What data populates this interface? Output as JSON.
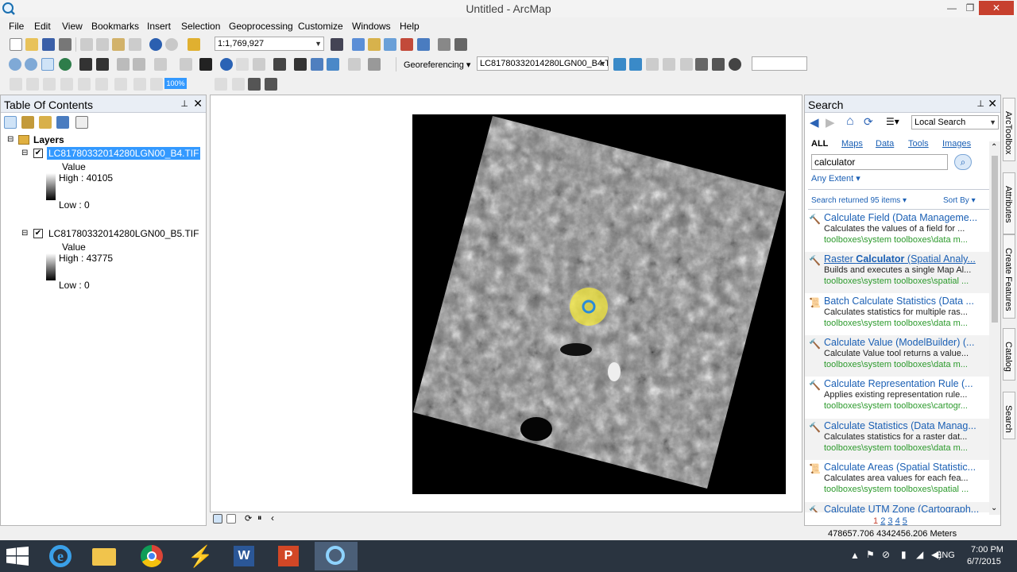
{
  "window": {
    "title": "Untitled - ArcMap",
    "minimize": "—",
    "maximize": "❐",
    "close": "✕"
  },
  "menu": [
    "File",
    "Edit",
    "View",
    "Bookmarks",
    "Insert",
    "Selection",
    "Geoprocessing",
    "Customize",
    "Windows",
    "Help"
  ],
  "toolbar": {
    "scale": "1:1,769,927",
    "georef_label": "Georeferencing ▾",
    "georef_layer": "LC81780332014280LGN00_B4.T",
    "georef_input": "",
    "selected_tool_value": "100%"
  },
  "toc": {
    "title": "Table Of Contents",
    "pin": "📌",
    "close": "✕",
    "layers_label": "Layers",
    "layer1": {
      "name": "LC81780332014280LGN00_B4.TIF",
      "field": "Value",
      "high": "High : 40105",
      "low": "Low : 0"
    },
    "layer2": {
      "name": "LC81780332014280LGN00_B5.TIF",
      "field": "Value",
      "high": "High : 43775",
      "low": "Low : 0"
    }
  },
  "search": {
    "title": "Search",
    "scope": "Local Search",
    "tabs": [
      "ALL",
      "Maps",
      "Data",
      "Tools",
      "Images"
    ],
    "query": "calculator",
    "extent": "Any Extent ▾",
    "count": "Search returned 95 items ▾",
    "sort": "Sort By ▾",
    "results": [
      {
        "title": "Calculate Field (Data Manageme...",
        "desc": "Calculates the values of a field for ...",
        "path": "toolboxes\\system toolboxes\\data m..."
      },
      {
        "title_pre": "Raster ",
        "title_bold": "Calculator",
        "title_post": " (Spatial Analy...",
        "desc": "Builds and executes a single Map Al...",
        "path": "toolboxes\\system toolboxes\\spatial ..."
      },
      {
        "title": "Batch Calculate Statistics (Data ...",
        "desc": "Calculates statistics for multiple ras...",
        "path": "toolboxes\\system toolboxes\\data m..."
      },
      {
        "title": "Calculate Value (ModelBuilder) (...",
        "desc": "Calculate Value tool returns a value...",
        "path": "toolboxes\\system toolboxes\\data m..."
      },
      {
        "title": "Calculate Representation Rule (...",
        "desc": "Applies existing representation rule...",
        "path": "toolboxes\\system toolboxes\\cartogr..."
      },
      {
        "title": "Calculate Statistics (Data Manag...",
        "desc": "Calculates statistics for a raster dat...",
        "path": "toolboxes\\system toolboxes\\data m..."
      },
      {
        "title": "Calculate Areas (Spatial Statistic...",
        "desc": "Calculates area values for each fea...",
        "path": "toolboxes\\system toolboxes\\spatial ..."
      },
      {
        "title": "Calculate UTM Zone (Cartograph...",
        "desc": "",
        "path": ""
      }
    ],
    "pages": [
      "1",
      "2",
      "3",
      "4",
      "5"
    ]
  },
  "dock_tabs": [
    "ArcToolbox",
    "Attributes",
    "Create Features",
    "Catalog",
    "Search"
  ],
  "status": {
    "coords": "478657.706  4342456.206 Meters"
  },
  "taskbar": {
    "lang": "ENG",
    "time": "7:00 PM",
    "date": "6/7/2015"
  },
  "colors": {
    "highlight": "#3399ff",
    "link": "#1a5fb4",
    "path": "#2c9a2c"
  }
}
